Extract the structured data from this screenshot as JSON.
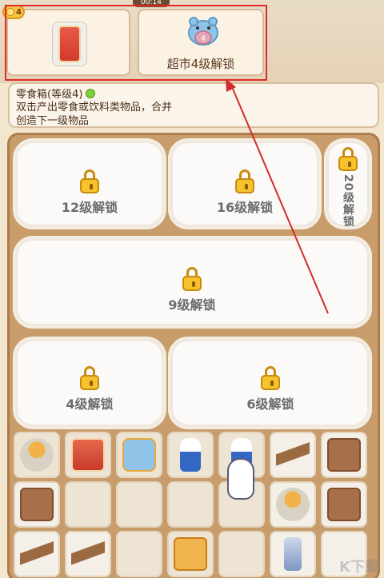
{
  "header": {
    "timer": "00:14",
    "coin_count": "4"
  },
  "top_cards": {
    "unlock_card_label": "超市4级解锁",
    "hippo_badge_number": "4"
  },
  "info": {
    "title": "零食箱(等级4)",
    "description_line1": "双击产出零食或饮料类物品，合并",
    "description_line2": "创造下一级物品"
  },
  "locked_zones": [
    {
      "label": "12级解锁"
    },
    {
      "label": "16级解锁"
    },
    {
      "label": "20级解锁"
    },
    {
      "label": "9级解锁"
    },
    {
      "label": "4级解锁"
    },
    {
      "label": "6级解锁"
    }
  ],
  "grid_items": [
    {
      "icon": "noodle-cup-icon"
    },
    {
      "icon": "snack-bag-icon"
    },
    {
      "icon": "hippo-crate-icon"
    },
    {
      "icon": "milk-bottle-icon"
    },
    {
      "icon": "milk-bottle-icon"
    },
    {
      "icon": "wood-plank-icon"
    },
    {
      "icon": "cardboard-box-icon"
    },
    {
      "icon": "open-box-icon"
    },
    {
      "icon": "empty"
    },
    {
      "icon": "empty"
    },
    {
      "icon": "empty"
    },
    {
      "icon": "empty"
    },
    {
      "icon": "noodle-cup-icon"
    },
    {
      "icon": "cardboard-box-icon"
    },
    {
      "icon": "wood-plank-icon"
    },
    {
      "icon": "wood-plank-icon"
    },
    {
      "icon": "empty"
    },
    {
      "icon": "snack-gift-box-icon"
    },
    {
      "icon": "empty"
    },
    {
      "icon": "soda-can-icon"
    },
    {
      "icon": "empty"
    }
  ],
  "watermark": "K下载",
  "colors": {
    "highlight_border": "#e02a2a",
    "lock_gold": "#f6c22e",
    "board_brown": "#c99c6b"
  }
}
